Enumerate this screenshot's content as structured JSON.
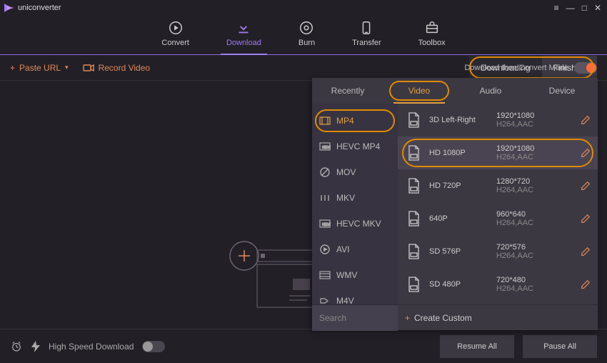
{
  "app": {
    "name": "uniconverter"
  },
  "window_controls": {
    "menu": "≡",
    "minimize": "—",
    "maximize": "□",
    "close": "✕"
  },
  "topnav": {
    "convert": "Convert",
    "download": "Download",
    "burn": "Burn",
    "transfer": "Transfer",
    "toolbox": "Toolbox",
    "active": "download"
  },
  "toolbar": {
    "paste_url": "Paste URL",
    "record_video": "Record Video",
    "tabs": {
      "downloading": "Downloading",
      "finished": "Finished"
    },
    "dtcm_label": "Download then Convert Mode"
  },
  "format_panel": {
    "categories": {
      "recently": "Recently",
      "video": "Video",
      "audio": "Audio",
      "device": "Device"
    },
    "formats": [
      {
        "name": "MP4"
      },
      {
        "name": "HEVC MP4"
      },
      {
        "name": "MOV"
      },
      {
        "name": "MKV"
      },
      {
        "name": "HEVC MKV"
      },
      {
        "name": "AVI"
      },
      {
        "name": "WMV"
      },
      {
        "name": "M4V"
      }
    ],
    "presets": [
      {
        "name": "3D Left-Right",
        "resolution": "1920*1080",
        "codec": "H264,AAC"
      },
      {
        "name": "HD 1080P",
        "resolution": "1920*1080",
        "codec": "H264,AAC",
        "highlight": true
      },
      {
        "name": "HD 720P",
        "resolution": "1280*720",
        "codec": "H264,AAC"
      },
      {
        "name": "640P",
        "resolution": "960*640",
        "codec": "H264,AAC"
      },
      {
        "name": "SD 576P",
        "resolution": "720*576",
        "codec": "H264,AAC"
      },
      {
        "name": "SD 480P",
        "resolution": "720*480",
        "codec": "H264,AAC"
      }
    ],
    "search_placeholder": "Search",
    "create_custom": "Create Custom"
  },
  "footer": {
    "high_speed": "High Speed Download",
    "resume_all": "Resume All",
    "pause_all": "Pause All"
  },
  "colors": {
    "accent": "#e08a5a",
    "primary": "#a07cf0",
    "highlight_ring": "#e08a00"
  }
}
